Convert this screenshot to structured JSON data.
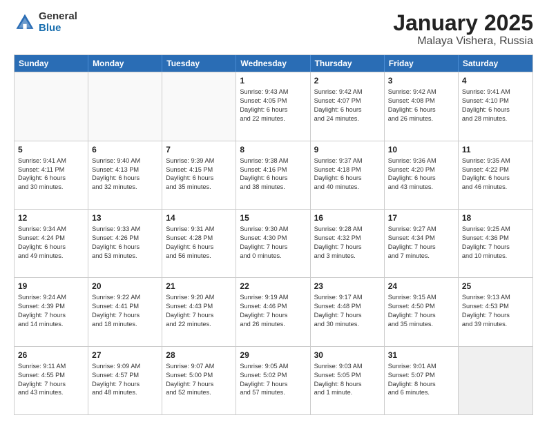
{
  "header": {
    "logo_general": "General",
    "logo_blue": "Blue",
    "title": "January 2025",
    "subtitle": "Malaya Vishera, Russia"
  },
  "weekdays": [
    "Sunday",
    "Monday",
    "Tuesday",
    "Wednesday",
    "Thursday",
    "Friday",
    "Saturday"
  ],
  "rows": [
    [
      {
        "day": "",
        "text": "",
        "empty": true
      },
      {
        "day": "",
        "text": "",
        "empty": true
      },
      {
        "day": "",
        "text": "",
        "empty": true
      },
      {
        "day": "1",
        "text": "Sunrise: 9:43 AM\nSunset: 4:05 PM\nDaylight: 6 hours\nand 22 minutes."
      },
      {
        "day": "2",
        "text": "Sunrise: 9:42 AM\nSunset: 4:07 PM\nDaylight: 6 hours\nand 24 minutes."
      },
      {
        "day": "3",
        "text": "Sunrise: 9:42 AM\nSunset: 4:08 PM\nDaylight: 6 hours\nand 26 minutes."
      },
      {
        "day": "4",
        "text": "Sunrise: 9:41 AM\nSunset: 4:10 PM\nDaylight: 6 hours\nand 28 minutes."
      }
    ],
    [
      {
        "day": "5",
        "text": "Sunrise: 9:41 AM\nSunset: 4:11 PM\nDaylight: 6 hours\nand 30 minutes."
      },
      {
        "day": "6",
        "text": "Sunrise: 9:40 AM\nSunset: 4:13 PM\nDaylight: 6 hours\nand 32 minutes."
      },
      {
        "day": "7",
        "text": "Sunrise: 9:39 AM\nSunset: 4:15 PM\nDaylight: 6 hours\nand 35 minutes."
      },
      {
        "day": "8",
        "text": "Sunrise: 9:38 AM\nSunset: 4:16 PM\nDaylight: 6 hours\nand 38 minutes."
      },
      {
        "day": "9",
        "text": "Sunrise: 9:37 AM\nSunset: 4:18 PM\nDaylight: 6 hours\nand 40 minutes."
      },
      {
        "day": "10",
        "text": "Sunrise: 9:36 AM\nSunset: 4:20 PM\nDaylight: 6 hours\nand 43 minutes."
      },
      {
        "day": "11",
        "text": "Sunrise: 9:35 AM\nSunset: 4:22 PM\nDaylight: 6 hours\nand 46 minutes."
      }
    ],
    [
      {
        "day": "12",
        "text": "Sunrise: 9:34 AM\nSunset: 4:24 PM\nDaylight: 6 hours\nand 49 minutes."
      },
      {
        "day": "13",
        "text": "Sunrise: 9:33 AM\nSunset: 4:26 PM\nDaylight: 6 hours\nand 53 minutes."
      },
      {
        "day": "14",
        "text": "Sunrise: 9:31 AM\nSunset: 4:28 PM\nDaylight: 6 hours\nand 56 minutes."
      },
      {
        "day": "15",
        "text": "Sunrise: 9:30 AM\nSunset: 4:30 PM\nDaylight: 7 hours\nand 0 minutes."
      },
      {
        "day": "16",
        "text": "Sunrise: 9:28 AM\nSunset: 4:32 PM\nDaylight: 7 hours\nand 3 minutes."
      },
      {
        "day": "17",
        "text": "Sunrise: 9:27 AM\nSunset: 4:34 PM\nDaylight: 7 hours\nand 7 minutes."
      },
      {
        "day": "18",
        "text": "Sunrise: 9:25 AM\nSunset: 4:36 PM\nDaylight: 7 hours\nand 10 minutes."
      }
    ],
    [
      {
        "day": "19",
        "text": "Sunrise: 9:24 AM\nSunset: 4:39 PM\nDaylight: 7 hours\nand 14 minutes."
      },
      {
        "day": "20",
        "text": "Sunrise: 9:22 AM\nSunset: 4:41 PM\nDaylight: 7 hours\nand 18 minutes."
      },
      {
        "day": "21",
        "text": "Sunrise: 9:20 AM\nSunset: 4:43 PM\nDaylight: 7 hours\nand 22 minutes."
      },
      {
        "day": "22",
        "text": "Sunrise: 9:19 AM\nSunset: 4:46 PM\nDaylight: 7 hours\nand 26 minutes."
      },
      {
        "day": "23",
        "text": "Sunrise: 9:17 AM\nSunset: 4:48 PM\nDaylight: 7 hours\nand 30 minutes."
      },
      {
        "day": "24",
        "text": "Sunrise: 9:15 AM\nSunset: 4:50 PM\nDaylight: 7 hours\nand 35 minutes."
      },
      {
        "day": "25",
        "text": "Sunrise: 9:13 AM\nSunset: 4:53 PM\nDaylight: 7 hours\nand 39 minutes."
      }
    ],
    [
      {
        "day": "26",
        "text": "Sunrise: 9:11 AM\nSunset: 4:55 PM\nDaylight: 7 hours\nand 43 minutes."
      },
      {
        "day": "27",
        "text": "Sunrise: 9:09 AM\nSunset: 4:57 PM\nDaylight: 7 hours\nand 48 minutes."
      },
      {
        "day": "28",
        "text": "Sunrise: 9:07 AM\nSunset: 5:00 PM\nDaylight: 7 hours\nand 52 minutes."
      },
      {
        "day": "29",
        "text": "Sunrise: 9:05 AM\nSunset: 5:02 PM\nDaylight: 7 hours\nand 57 minutes."
      },
      {
        "day": "30",
        "text": "Sunrise: 9:03 AM\nSunset: 5:05 PM\nDaylight: 8 hours\nand 1 minute."
      },
      {
        "day": "31",
        "text": "Sunrise: 9:01 AM\nSunset: 5:07 PM\nDaylight: 8 hours\nand 6 minutes."
      },
      {
        "day": "",
        "text": "",
        "empty": true,
        "shaded": true
      }
    ]
  ]
}
